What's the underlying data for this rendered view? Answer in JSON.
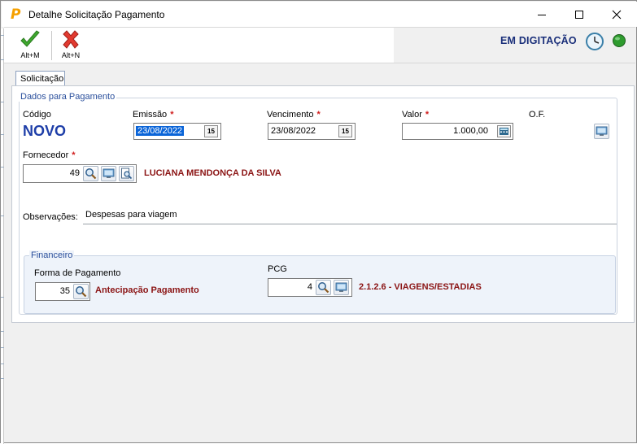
{
  "window": {
    "title": "Detalhe Solicitação Pagamento",
    "app_icon_letter": "P"
  },
  "toolbar": {
    "save_shortcut": "Alt+M",
    "cancel_shortcut": "Alt+N",
    "status": "EM DIGITAÇÃO"
  },
  "tabs": [
    {
      "label": "Solicitação",
      "active": true
    }
  ],
  "dados": {
    "legend": "Dados para Pagamento",
    "codigo": {
      "label": "Código",
      "value": "NOVO"
    },
    "emissao": {
      "label": "Emissão",
      "value": "23/08/2022"
    },
    "vencimento": {
      "label": "Vencimento",
      "value": "23/08/2022"
    },
    "valor": {
      "label": "Valor",
      "value": "1.000,00"
    },
    "of": {
      "label": "O.F."
    },
    "fornecedor": {
      "label": "Fornecedor",
      "value": "49",
      "name": "LUCIANA MENDONÇA DA SILVA"
    },
    "observacoes": {
      "label": "Observações:",
      "value": "Despesas para viagem"
    },
    "required_mark": "*"
  },
  "financeiro": {
    "legend": "Financeiro",
    "forma": {
      "label": "Forma de Pagamento",
      "value": "35",
      "desc": "Antecipação Pagamento"
    },
    "pcg": {
      "label": "PCG",
      "value": "4",
      "desc": "2.1.2.6 - VIAGENS/ESTADIAS"
    }
  },
  "colors": {
    "accent_blue": "#1e3ea8",
    "status_blue": "#1a2f7a",
    "required_red": "#d01c1c",
    "desc_red": "#8b1414",
    "legend_blue": "#2a4f9c",
    "selection_blue": "#0a64d8"
  },
  "icons": {
    "app": "p-logo-icon",
    "save": "checkmark-icon",
    "cancel": "red-x-icon",
    "clock": "clock-icon",
    "status_light": "green-status-icon",
    "calendar": "calendar-icon",
    "calculator": "calculator-icon",
    "search": "magnifier-icon",
    "monitor": "monitor-icon",
    "detail": "document-search-icon"
  }
}
